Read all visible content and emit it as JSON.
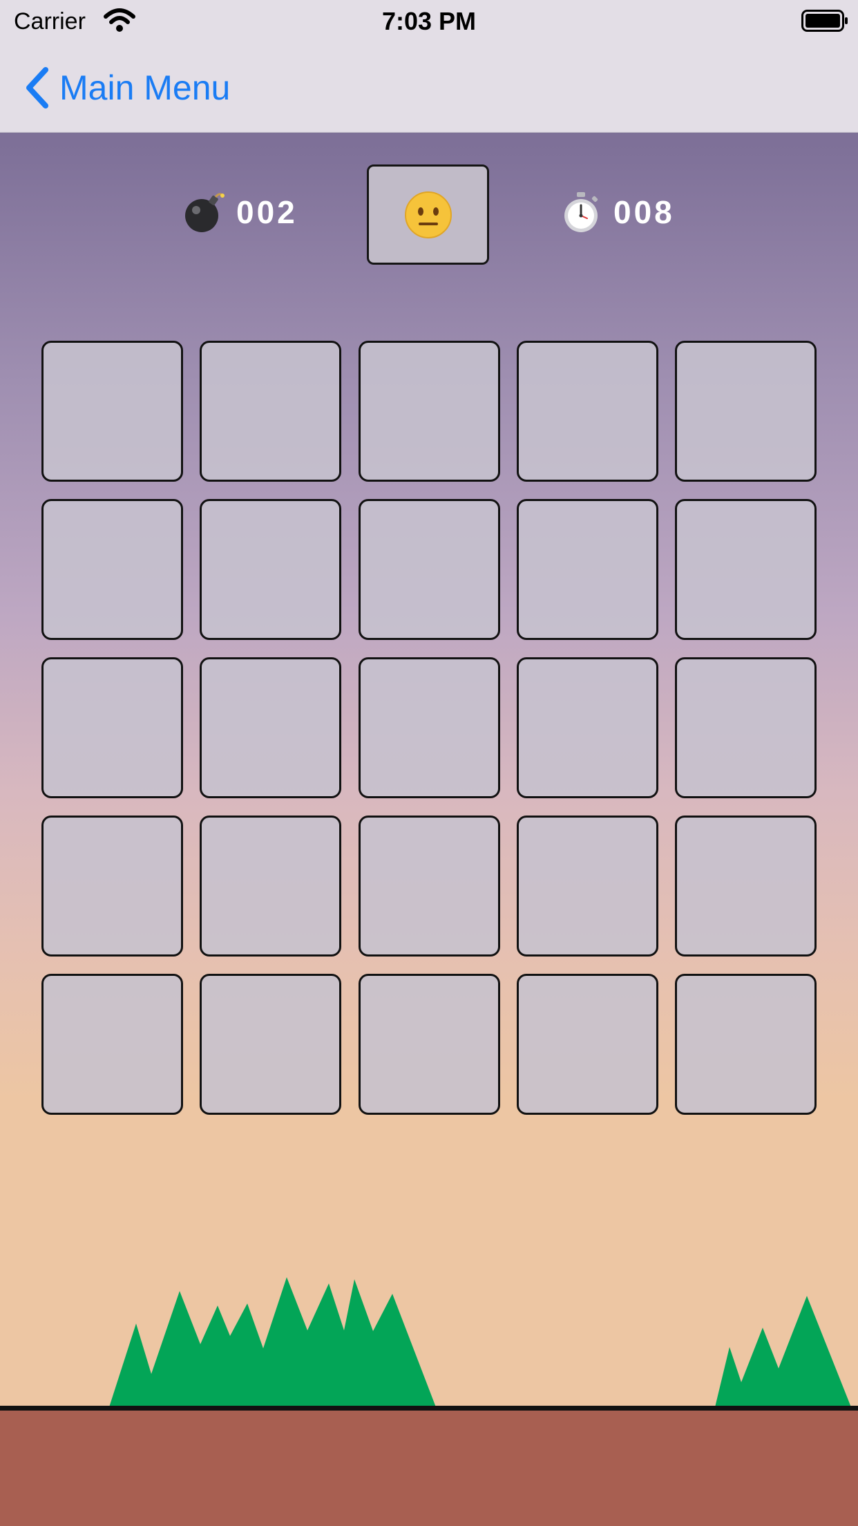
{
  "status_bar": {
    "carrier": "Carrier",
    "time": "7:03 PM"
  },
  "nav": {
    "back_label": "Main Menu"
  },
  "hud": {
    "mine_count": "002",
    "face_state": "neutral-face",
    "timer": "008"
  },
  "board": {
    "rows": 5,
    "cols": 5,
    "cells": [
      [
        "unrevealed",
        "unrevealed",
        "unrevealed",
        "unrevealed",
        "unrevealed"
      ],
      [
        "unrevealed",
        "unrevealed",
        "unrevealed",
        "unrevealed",
        "unrevealed"
      ],
      [
        "unrevealed",
        "unrevealed",
        "unrevealed",
        "unrevealed",
        "unrevealed"
      ],
      [
        "unrevealed",
        "unrevealed",
        "unrevealed",
        "unrevealed",
        "unrevealed"
      ],
      [
        "unrevealed",
        "unrevealed",
        "unrevealed",
        "unrevealed",
        "unrevealed"
      ]
    ]
  },
  "colors": {
    "accent": "#1a7cf4",
    "tree": "#03a557",
    "ground": "#a85f51",
    "cell": "#c6c1ce"
  },
  "icons": [
    "wifi-icon",
    "battery-icon",
    "back-chevron-icon",
    "bomb-icon",
    "neutral-face-icon",
    "stopwatch-icon"
  ]
}
